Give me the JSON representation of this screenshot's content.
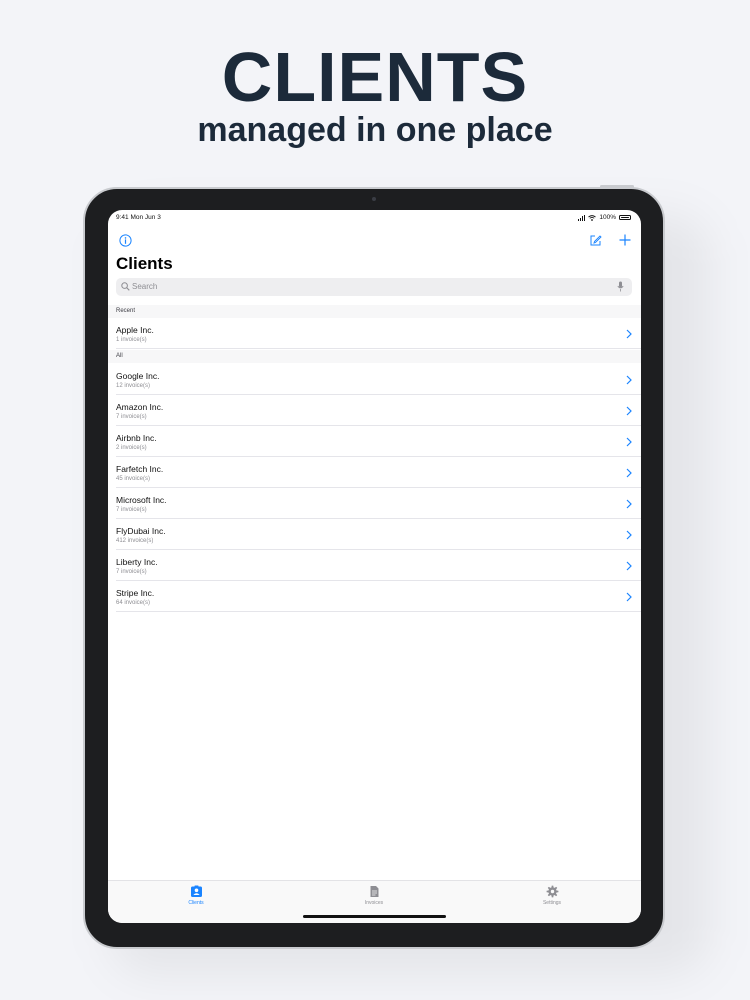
{
  "hero": {
    "title": "CLIENTS",
    "subtitle": "managed in one place"
  },
  "status_bar": {
    "time": "9:41 Mon Jun 3",
    "battery": "100%"
  },
  "nav": {
    "icons": [
      "info-icon",
      "compose-icon",
      "plus-icon"
    ],
    "title": "Clients"
  },
  "search": {
    "placeholder": "Search"
  },
  "sections": {
    "recent": {
      "header": "Recent",
      "rows": [
        {
          "name": "Apple Inc.",
          "count": "1 invoice(s)"
        }
      ]
    },
    "all": {
      "header": "All",
      "rows": [
        {
          "name": "Google Inc.",
          "count": "12 invoice(s)"
        },
        {
          "name": "Amazon Inc.",
          "count": "7 invoice(s)"
        },
        {
          "name": "Airbnb Inc.",
          "count": "2 invoice(s)"
        },
        {
          "name": "Farfetch Inc.",
          "count": "45 invoice(s)"
        },
        {
          "name": "Microsoft Inc.",
          "count": "7 invoice(s)"
        },
        {
          "name": "FlyDubai Inc.",
          "count": "412 invoice(s)"
        },
        {
          "name": "Liberty Inc.",
          "count": "7 invoice(s)"
        },
        {
          "name": "Stripe Inc.",
          "count": "64 invoice(s)"
        }
      ]
    }
  },
  "tabbar": {
    "tabs": [
      {
        "label": "Clients",
        "icon": "person-card-icon",
        "active": true
      },
      {
        "label": "Invoices",
        "icon": "document-icon",
        "active": false
      },
      {
        "label": "Settings",
        "icon": "gear-icon",
        "active": false
      }
    ]
  },
  "colors": {
    "accent": "#1a84ff",
    "hero_text": "#1c2a3a",
    "inactive_tab": "#8e8e93",
    "background": "#f3f4f8"
  }
}
